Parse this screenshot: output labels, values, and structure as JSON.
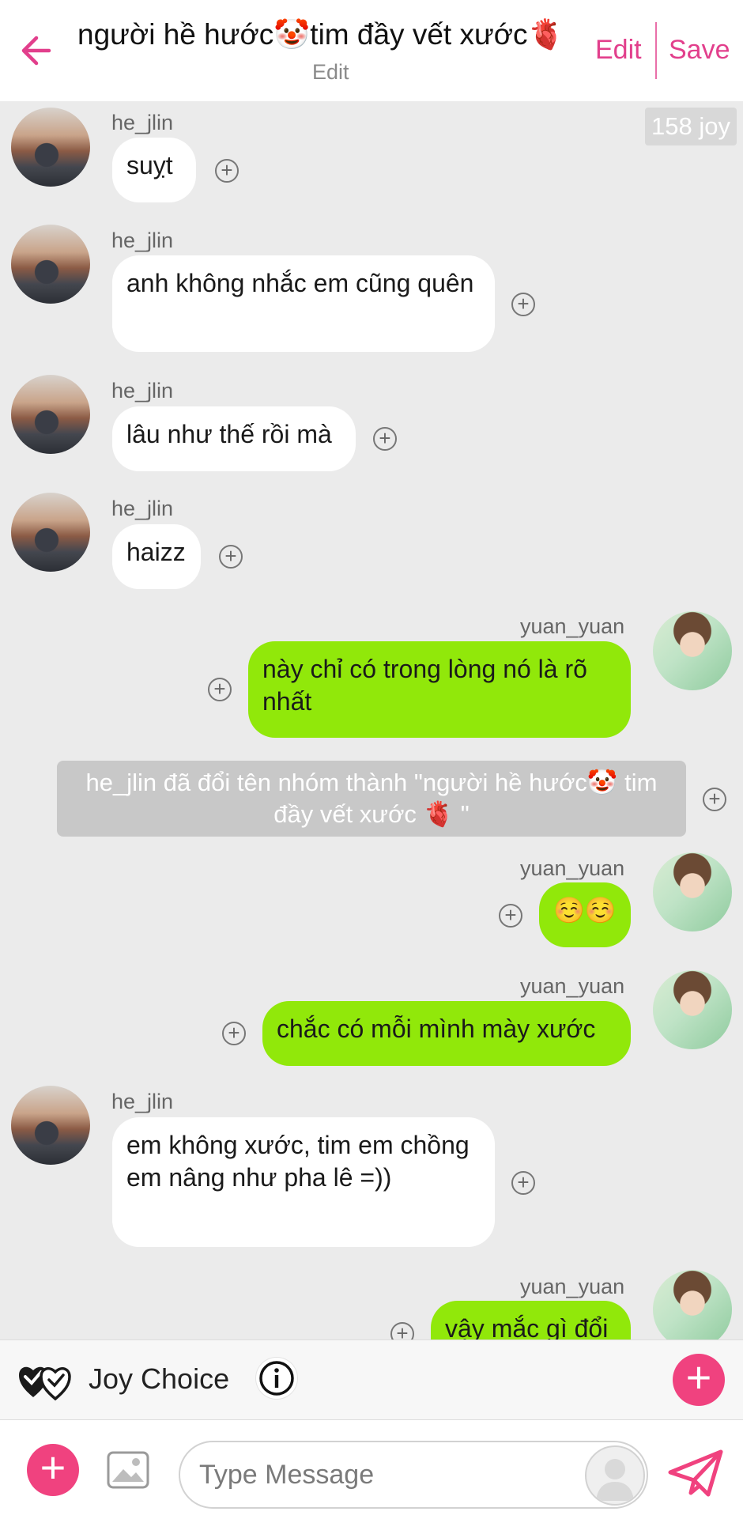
{
  "header": {
    "title": "người hề hước🤡tim đầy vết xước🫀",
    "subtitle": "Edit",
    "edit_label": "Edit",
    "save_label": "Save"
  },
  "joy_badge": "158 joy",
  "messages": [
    {
      "sender": "he_jlin",
      "side": "left",
      "text": "suỵt"
    },
    {
      "sender": "he_jlin",
      "side": "left",
      "text": "anh không nhắc em cũng quên"
    },
    {
      "sender": "he_jlin",
      "side": "left",
      "text": "lâu như thế rồi mà"
    },
    {
      "sender": "he_jlin",
      "side": "left",
      "text": "haizz"
    },
    {
      "sender": "yuan_yuan",
      "side": "right",
      "text": "này chỉ có trong lòng nó là rõ nhất"
    },
    {
      "sender": "yuan_yuan",
      "side": "right",
      "text": "☺️☺️"
    },
    {
      "sender": "yuan_yuan",
      "side": "right",
      "text": "chắc có mỗi mình mày xước"
    },
    {
      "sender": "he_jlin",
      "side": "left",
      "text": "em không xước, tim em chồng em nâng như pha lê =))"
    },
    {
      "sender": "yuan_yuan",
      "side": "right",
      "text": "vậy mắc gì đổi"
    }
  ],
  "system_message": "he_jlin đã đổi tên nhóm thành \"người hề hước🤡 tim đầy vết xước 🫀 \"",
  "joy_choice": {
    "label": "Joy Choice"
  },
  "composer": {
    "placeholder": "Type Message"
  },
  "colors": {
    "accent": "#e23f8c",
    "sent_bubble": "#91e80a",
    "received_bubble": "#ffffff",
    "fab": "#f0427f"
  }
}
